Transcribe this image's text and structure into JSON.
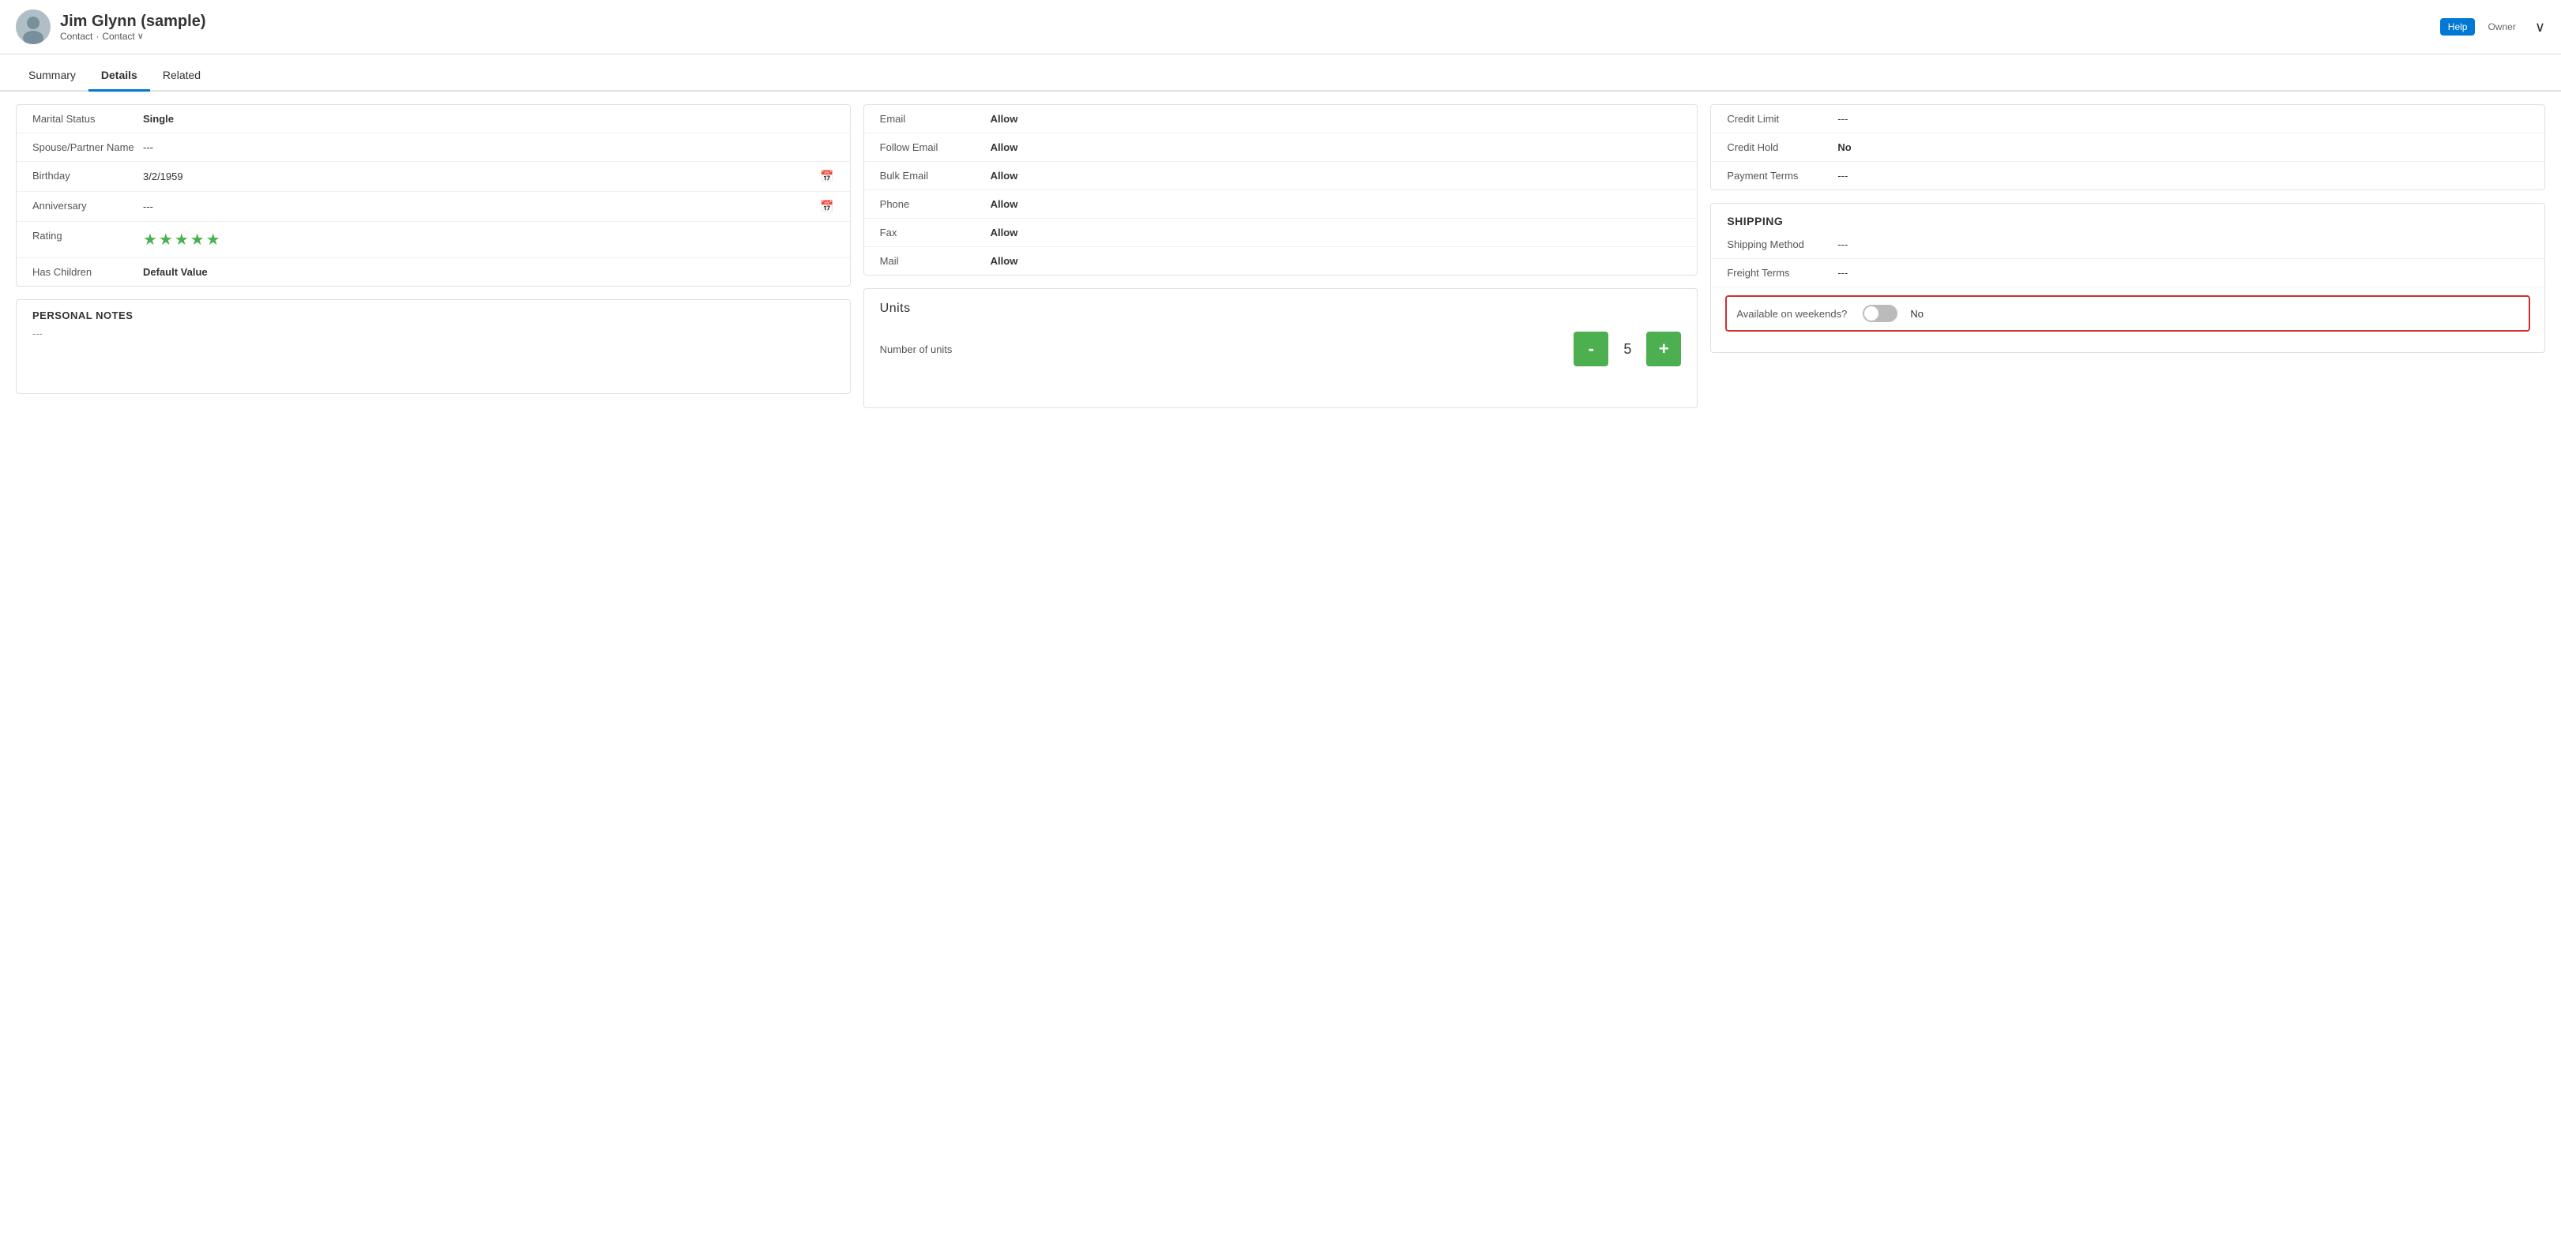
{
  "header": {
    "name": "Jim Glynn (sample)",
    "breadcrumb1": "Contact",
    "separator": "·",
    "breadcrumb2": "Contact",
    "owner_label": "Owner",
    "help_label": "Help",
    "chevron": "∨"
  },
  "tabs": {
    "summary": "Summary",
    "details": "Details",
    "related": "Related"
  },
  "personal_info": {
    "title": "",
    "fields": [
      {
        "label": "Marital Status",
        "value": "Single",
        "bold": true,
        "has_calendar": false
      },
      {
        "label": "Spouse/Partner Name",
        "value": "---",
        "bold": false,
        "has_calendar": false
      },
      {
        "label": "Birthday",
        "value": "3/2/1959",
        "bold": false,
        "has_calendar": true
      },
      {
        "label": "Anniversary",
        "value": "---",
        "bold": false,
        "has_calendar": true
      },
      {
        "label": "Rating",
        "value": "★★★★★",
        "bold": false,
        "is_stars": true,
        "has_calendar": false
      },
      {
        "label": "Has Children",
        "value": "Default Value",
        "bold": true,
        "has_calendar": false
      }
    ]
  },
  "personal_notes": {
    "title": "PERSONAL NOTES",
    "value": "---"
  },
  "contact_preferences": {
    "fields": [
      {
        "label": "Email",
        "value": "Allow",
        "bold": true
      },
      {
        "label": "Follow Email",
        "value": "Allow",
        "bold": true
      },
      {
        "label": "Bulk Email",
        "value": "Allow",
        "bold": true
      },
      {
        "label": "Phone",
        "value": "Allow",
        "bold": true
      },
      {
        "label": "Fax",
        "value": "Allow",
        "bold": true
      },
      {
        "label": "Mail",
        "value": "Allow",
        "bold": true
      }
    ]
  },
  "units": {
    "section_title": "Units",
    "field_label": "Number of units",
    "value": "5",
    "minus_label": "-",
    "plus_label": "+"
  },
  "credit_info": {
    "fields": [
      {
        "label": "Credit Limit",
        "value": "---",
        "bold": false
      },
      {
        "label": "Credit Hold",
        "value": "No",
        "bold": true
      },
      {
        "label": "Payment Terms",
        "value": "---",
        "bold": false
      }
    ]
  },
  "shipping": {
    "title": "SHIPPING",
    "fields": [
      {
        "label": "Shipping Method",
        "value": "---",
        "bold": false
      },
      {
        "label": "Freight Terms",
        "value": "---",
        "bold": false
      }
    ],
    "weekend_label": "Available on weekends?",
    "weekend_value": "No",
    "weekend_toggle": false
  },
  "colors": {
    "accent": "#0078d4",
    "green": "#4caf50",
    "star": "#4caf50",
    "danger": "#d32f2f"
  }
}
